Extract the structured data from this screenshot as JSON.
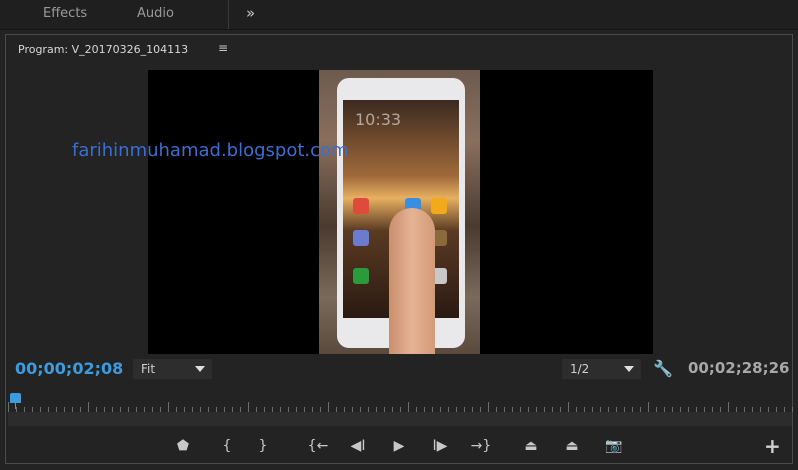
{
  "tabs": [
    {
      "label": "Effects"
    },
    {
      "label": "Audio"
    }
  ],
  "overflow_glyph": "»",
  "panel": {
    "title": "Program: V_20170326_104113",
    "menu_glyph": "≡"
  },
  "video": {
    "clock_text": "10:33",
    "watermark": "farihinmuhamad.blogspot.com"
  },
  "timecodes": {
    "current": "00;00;02;08",
    "duration": "00;02;28;26"
  },
  "zoom_select": {
    "value": "Fit"
  },
  "resolution_select": {
    "value": "1/2"
  },
  "icons": {
    "settings": "wrench-icon",
    "add_button": "+"
  },
  "transport": [
    {
      "name": "add-marker-button",
      "glyph": "⬟"
    },
    {
      "name": "mark-in-button",
      "glyph": "{"
    },
    {
      "name": "mark-out-button",
      "glyph": "}"
    },
    {
      "name": "go-to-in-button",
      "glyph": "{←"
    },
    {
      "name": "step-back-button",
      "glyph": "◀I"
    },
    {
      "name": "play-button",
      "glyph": "▶"
    },
    {
      "name": "step-forward-button",
      "glyph": "I▶"
    },
    {
      "name": "go-to-out-button",
      "glyph": "→}"
    },
    {
      "name": "lift-button",
      "glyph": "⏏"
    },
    {
      "name": "extract-button",
      "glyph": "⏏"
    },
    {
      "name": "export-frame-button",
      "glyph": "📷"
    }
  ],
  "colors": {
    "accent": "#3d9be0",
    "panel_bg": "#232323",
    "watermark": "#3a6fd0"
  }
}
